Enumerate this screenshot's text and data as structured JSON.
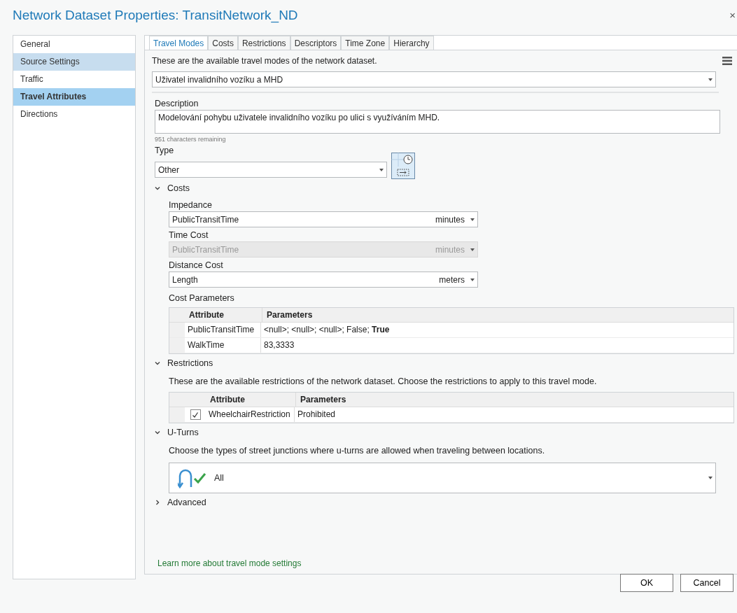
{
  "window": {
    "title": "Network Dataset Properties: TransitNetwork_ND",
    "close": "×"
  },
  "sidebar": {
    "items": [
      {
        "label": "General",
        "selected": false,
        "hovered": false
      },
      {
        "label": "Source Settings",
        "selected": false,
        "hovered": true
      },
      {
        "label": "Traffic",
        "selected": false,
        "hovered": false
      },
      {
        "label": "Travel Attributes",
        "selected": true,
        "hovered": false
      },
      {
        "label": "Directions",
        "selected": false,
        "hovered": false
      }
    ]
  },
  "tabs": [
    {
      "label": "Travel Modes",
      "selected": true
    },
    {
      "label": "Costs",
      "selected": false
    },
    {
      "label": "Restrictions",
      "selected": false
    },
    {
      "label": "Descriptors",
      "selected": false
    },
    {
      "label": "Time Zone",
      "selected": false
    },
    {
      "label": "Hierarchy",
      "selected": false
    }
  ],
  "intro": "These are the available travel modes of the network dataset.",
  "travel_mode": {
    "value": "Uživatel invalidního vozíku a MHD"
  },
  "description": {
    "label": "Description",
    "value": "Modelování pohybu uživatele invalidního vozíku po ulici s využíváním MHD.",
    "remaining": "951 characters remaining"
  },
  "type": {
    "label": "Type",
    "value": "Other"
  },
  "costs": {
    "title": "Costs",
    "expanded": true,
    "fields": [
      {
        "label": "Impedance",
        "value": "PublicTransitTime",
        "unit": "minutes",
        "disabled": false
      },
      {
        "label": "Time Cost",
        "value": "PublicTransitTime",
        "unit": "minutes",
        "disabled": true
      },
      {
        "label": "Distance Cost",
        "value": "Length",
        "unit": "meters",
        "disabled": false
      }
    ],
    "parameters_label": "Cost Parameters",
    "columns": [
      "Attribute",
      "Parameters"
    ],
    "rows": [
      {
        "attribute": "PublicTransitTime",
        "parameters": "<null>; <null>; <null>; False; **True**"
      },
      {
        "attribute": "WalkTime",
        "parameters": "83,3333"
      }
    ]
  },
  "restrictions": {
    "title": "Restrictions",
    "expanded": true,
    "text": "These are the available restrictions of the network dataset. Choose the restrictions to apply to this travel mode.",
    "columns": [
      "Attribute",
      "Parameters"
    ],
    "rows": [
      {
        "checked": true,
        "attribute": "WheelchairRestriction",
        "parameters": "Prohibited"
      }
    ]
  },
  "uturns": {
    "title": "U-Turns",
    "expanded": true,
    "text": "Choose the types of street junctions where u-turns are allowed when traveling between locations.",
    "value": "All"
  },
  "advanced": {
    "title": "Advanced",
    "expanded": false
  },
  "link": "Learn more about travel mode settings",
  "buttons": [
    "OK",
    "Cancel"
  ]
}
